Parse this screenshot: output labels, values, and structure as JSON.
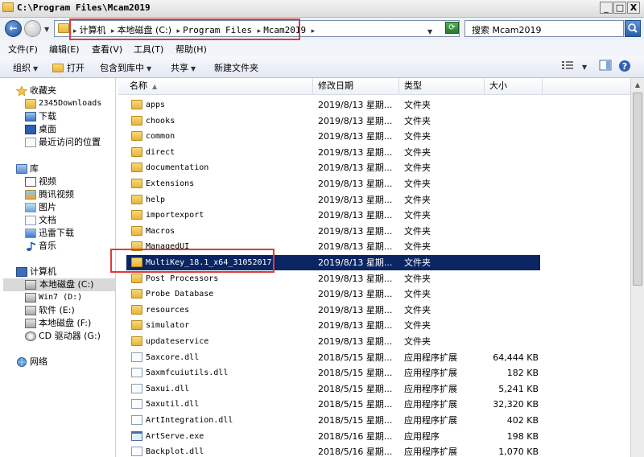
{
  "window": {
    "title": "C:\\Program Files\\Mcam2019",
    "minimize": "_",
    "maximize": "□",
    "close": "X"
  },
  "address": {
    "crumbs": [
      "计算机",
      "本地磁盘 (C:)",
      "Program Files",
      "Mcam2019"
    ],
    "search_placeholder": "搜索 Mcam2019"
  },
  "menubar": {
    "items": [
      "文件(F)",
      "编辑(E)",
      "查看(V)",
      "工具(T)",
      "帮助(H)"
    ]
  },
  "toolbar": {
    "organize": "组织",
    "open": "打开",
    "include_library": "包含到库中",
    "share": "共享",
    "new_folder": "新建文件夹"
  },
  "navpane": {
    "favorites": {
      "label": "收藏夹",
      "items": [
        "2345Downloads",
        "下载",
        "桌面",
        "最近访问的位置"
      ]
    },
    "libraries": {
      "label": "库",
      "items": [
        "视频",
        "腾讯视频",
        "图片",
        "文档",
        "迅雷下载",
        "音乐"
      ]
    },
    "computer": {
      "label": "计算机",
      "items": [
        "本地磁盘 (C:)",
        "Win7 (D:)",
        "软件 (E:)",
        "本地磁盘 (F:)",
        "CD 驱动器 (G:)"
      ]
    },
    "network": {
      "label": "网络"
    }
  },
  "columns": {
    "name": "名称",
    "date": "修改日期",
    "type": "类型",
    "size": "大小"
  },
  "files": [
    {
      "name": "apps",
      "date": "2019/8/13 星期...",
      "type": "文件夹",
      "size": "",
      "kind": "folder"
    },
    {
      "name": "chooks",
      "date": "2019/8/13 星期...",
      "type": "文件夹",
      "size": "",
      "kind": "folder"
    },
    {
      "name": "common",
      "date": "2019/8/13 星期...",
      "type": "文件夹",
      "size": "",
      "kind": "folder"
    },
    {
      "name": "direct",
      "date": "2019/8/13 星期...",
      "type": "文件夹",
      "size": "",
      "kind": "folder"
    },
    {
      "name": "documentation",
      "date": "2019/8/13 星期...",
      "type": "文件夹",
      "size": "",
      "kind": "folder"
    },
    {
      "name": "Extensions",
      "date": "2019/8/13 星期...",
      "type": "文件夹",
      "size": "",
      "kind": "folder"
    },
    {
      "name": "help",
      "date": "2019/8/13 星期...",
      "type": "文件夹",
      "size": "",
      "kind": "folder"
    },
    {
      "name": "importexport",
      "date": "2019/8/13 星期...",
      "type": "文件夹",
      "size": "",
      "kind": "folder"
    },
    {
      "name": "Macros",
      "date": "2019/8/13 星期...",
      "type": "文件夹",
      "size": "",
      "kind": "folder"
    },
    {
      "name": "ManagedUI",
      "date": "2019/8/13 星期...",
      "type": "文件夹",
      "size": "",
      "kind": "folder"
    },
    {
      "name": "MultiKey_18.1_x64_31052017",
      "date": "2019/8/13 星期...",
      "type": "文件夹",
      "size": "",
      "kind": "folder",
      "selected": true
    },
    {
      "name": "Post Processors",
      "date": "2019/8/13 星期...",
      "type": "文件夹",
      "size": "",
      "kind": "folder"
    },
    {
      "name": "Probe Database",
      "date": "2019/8/13 星期...",
      "type": "文件夹",
      "size": "",
      "kind": "folder"
    },
    {
      "name": "resources",
      "date": "2019/8/13 星期...",
      "type": "文件夹",
      "size": "",
      "kind": "folder"
    },
    {
      "name": "simulator",
      "date": "2019/8/13 星期...",
      "type": "文件夹",
      "size": "",
      "kind": "folder"
    },
    {
      "name": "updateservice",
      "date": "2019/8/13 星期...",
      "type": "文件夹",
      "size": "",
      "kind": "folder"
    },
    {
      "name": "5axcore.dll",
      "date": "2018/5/15 星期...",
      "type": "应用程序扩展",
      "size": "64,444 KB",
      "kind": "dll"
    },
    {
      "name": "5axmfcuiutils.dll",
      "date": "2018/5/15 星期...",
      "type": "应用程序扩展",
      "size": "182 KB",
      "kind": "dll"
    },
    {
      "name": "5axui.dll",
      "date": "2018/5/15 星期...",
      "type": "应用程序扩展",
      "size": "5,241 KB",
      "kind": "dll"
    },
    {
      "name": "5axutil.dll",
      "date": "2018/5/15 星期...",
      "type": "应用程序扩展",
      "size": "32,320 KB",
      "kind": "dll"
    },
    {
      "name": "ArtIntegration.dll",
      "date": "2018/5/15 星期...",
      "type": "应用程序扩展",
      "size": "402 KB",
      "kind": "dll"
    },
    {
      "name": "ArtServe.exe",
      "date": "2018/5/16 星期...",
      "type": "应用程序",
      "size": "198 KB",
      "kind": "exe"
    },
    {
      "name": "Backplot.dll",
      "date": "2018/5/16 星期...",
      "type": "应用程序扩展",
      "size": "1,070 KB",
      "kind": "dll"
    }
  ]
}
